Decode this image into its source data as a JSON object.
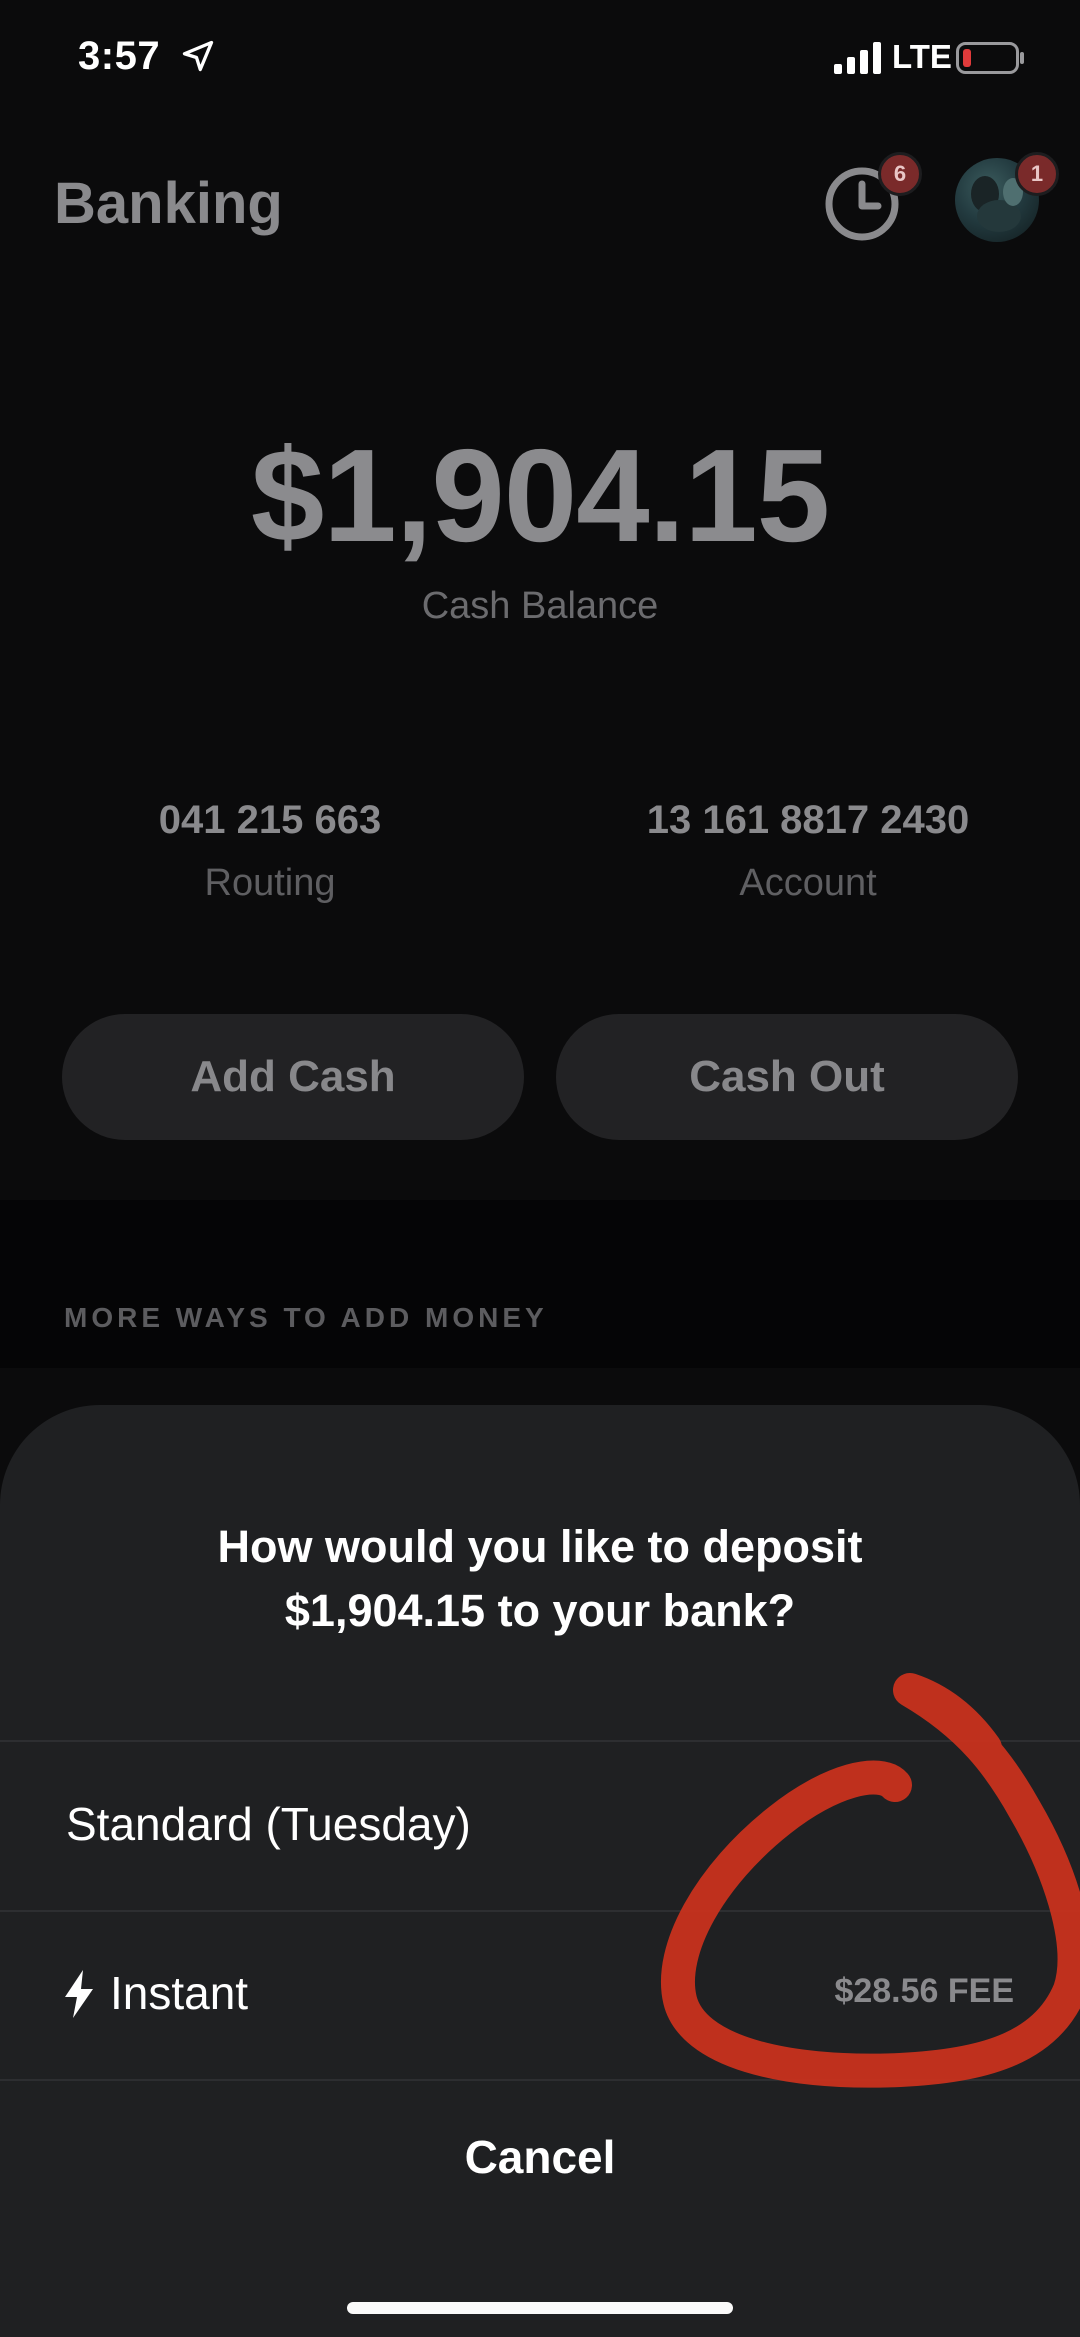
{
  "status_bar": {
    "time": "3:57",
    "network": "LTE",
    "battery_color": "#e03b3b"
  },
  "header": {
    "title": "Banking",
    "activity_badge": "6",
    "avatar_badge": "1"
  },
  "balance": {
    "amount": "$1,904.15",
    "label": "Cash Balance"
  },
  "routing": {
    "number": "041 215 663",
    "label": "Routing"
  },
  "account": {
    "number": "13 161 8817 2430",
    "label": "Account"
  },
  "actions": {
    "add_cash": "Add Cash",
    "cash_out": "Cash Out"
  },
  "section": {
    "title": "MORE WAYS TO ADD MONEY"
  },
  "sheet": {
    "title_line1": "How would you like to deposit",
    "title_line2": "$1,904.15 to your bank?",
    "options": [
      {
        "label": "Standard (Tuesday)",
        "fee": ""
      },
      {
        "label": "Instant",
        "fee": "$28.56 FEE",
        "icon": "lightning-bolt-icon"
      }
    ],
    "cancel": "Cancel"
  },
  "annotation_color": "#c8321d"
}
